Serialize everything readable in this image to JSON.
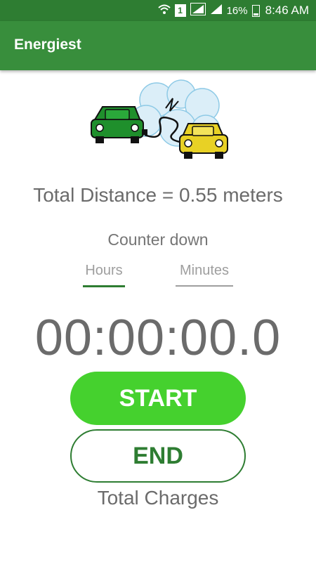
{
  "status_bar": {
    "battery_percent": "16%",
    "time": "8:46 AM",
    "sim_slot": "1"
  },
  "app_bar": {
    "title": "Energiest"
  },
  "hero": {
    "image": "cars-charging-illustration"
  },
  "main": {
    "distance_text": "Total Distance = 0.55 meters",
    "counter_label": "Counter down",
    "tabs": [
      {
        "label": "Hours",
        "selected": true
      },
      {
        "label": "Minutes",
        "selected": false
      }
    ],
    "timer": "00:00:00.0",
    "start_label": "START",
    "end_label": "END",
    "charges_label": "Total Charges"
  },
  "colors": {
    "status_bar": "#2e7d32",
    "app_bar": "#388e3c",
    "start_button": "#45d12e",
    "end_border": "#2e7d32"
  }
}
